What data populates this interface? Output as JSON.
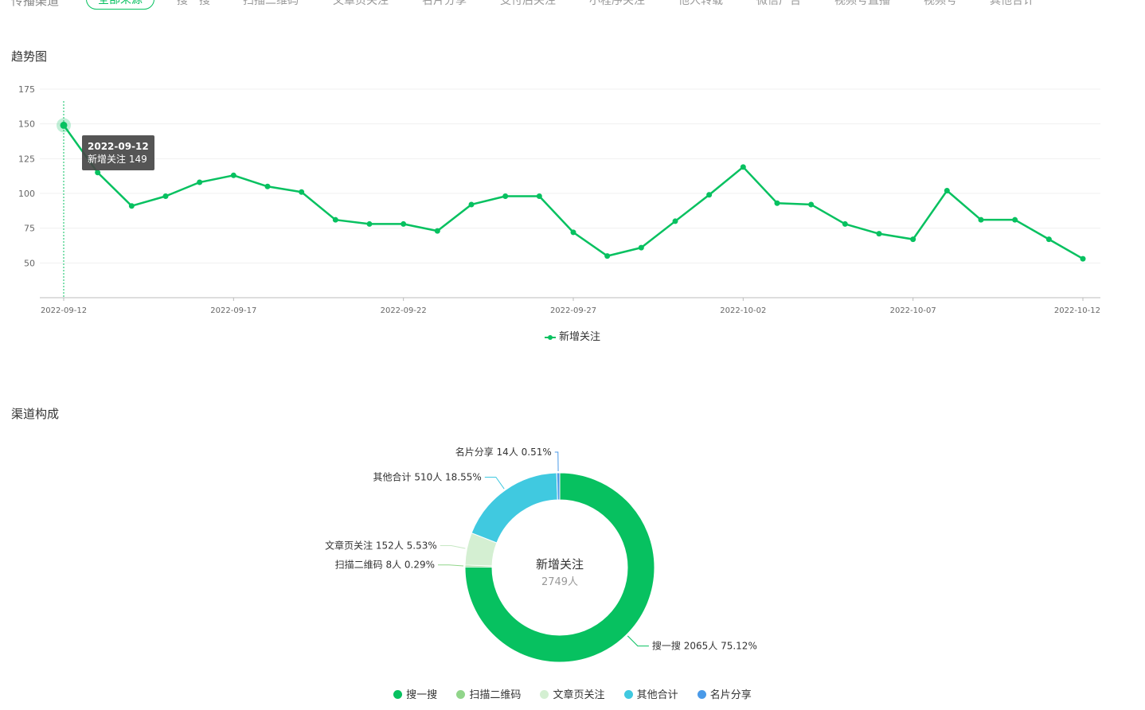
{
  "header": {
    "channel_label": "传播渠道",
    "tabs": [
      {
        "label": "全部来源",
        "active": true
      },
      {
        "label": "搜一搜"
      },
      {
        "label": "扫描二维码"
      },
      {
        "label": "文章页关注"
      },
      {
        "label": "名片分享"
      },
      {
        "label": "支付后关注"
      },
      {
        "label": "小程序关注"
      },
      {
        "label": "他人转载"
      },
      {
        "label": "微信广告"
      },
      {
        "label": "视频号直播"
      },
      {
        "label": "视频号"
      },
      {
        "label": "其他合计"
      }
    ]
  },
  "sections": {
    "trend_title": "趋势图",
    "channel_title": "渠道构成"
  },
  "tooltip": {
    "date": "2022-09-12",
    "text": "新增关注 149"
  },
  "colors": {
    "accent": "#07c160",
    "search": "#07c160",
    "qrcode": "#91d58a",
    "article": "#d4efd2",
    "other": "#40c9e0",
    "card": "#4a9ae8"
  },
  "chart_data": [
    {
      "type": "line",
      "x": [
        "2022-09-12",
        "2022-09-13",
        "2022-09-14",
        "2022-09-15",
        "2022-09-16",
        "2022-09-17",
        "2022-09-18",
        "2022-09-19",
        "2022-09-20",
        "2022-09-21",
        "2022-09-22",
        "2022-09-23",
        "2022-09-24",
        "2022-09-25",
        "2022-09-26",
        "2022-09-27",
        "2022-09-28",
        "2022-09-29",
        "2022-09-30",
        "2022-10-01",
        "2022-10-02",
        "2022-10-03",
        "2022-10-04",
        "2022-10-05",
        "2022-10-06",
        "2022-10-07",
        "2022-10-08",
        "2022-10-09",
        "2022-10-10",
        "2022-10-11",
        "2022-10-12"
      ],
      "xticks": [
        "2022-09-12",
        "2022-09-17",
        "2022-09-22",
        "2022-09-27",
        "2022-10-02",
        "2022-10-07",
        "2022-10-12"
      ],
      "series": [
        {
          "name": "新增关注",
          "values": [
            149,
            115,
            91,
            98,
            108,
            113,
            105,
            101,
            81,
            78,
            78,
            73,
            92,
            98,
            98,
            72,
            55,
            61,
            80,
            99,
            119,
            93,
            92,
            78,
            71,
            67,
            102,
            81,
            81,
            67,
            53
          ]
        }
      ],
      "yticks": [
        50,
        75,
        100,
        125,
        150,
        175
      ],
      "ylim": [
        25,
        175
      ],
      "grid": true,
      "legend": "bottom-center"
    },
    {
      "type": "pie",
      "center_title": "新增关注",
      "center_value": "2749人",
      "slices": [
        {
          "name": "搜一搜",
          "value": 2065,
          "percent": 75.12,
          "label": "搜一搜 2065人 75.12%",
          "color": "#07c160"
        },
        {
          "name": "扫描二维码",
          "value": 8,
          "percent": 0.29,
          "label": "扫描二维码 8人 0.29%",
          "color": "#91d58a"
        },
        {
          "name": "文章页关注",
          "value": 152,
          "percent": 5.53,
          "label": "文章页关注 152人 5.53%",
          "color": "#d4efd2"
        },
        {
          "name": "其他合计",
          "value": 510,
          "percent": 18.55,
          "label": "其他合计 510人 18.55%",
          "color": "#40c9e0"
        },
        {
          "name": "名片分享",
          "value": 14,
          "percent": 0.51,
          "label": "名片分享 14人 0.51%",
          "color": "#4a9ae8"
        }
      ],
      "legend": "bottom-center"
    }
  ]
}
